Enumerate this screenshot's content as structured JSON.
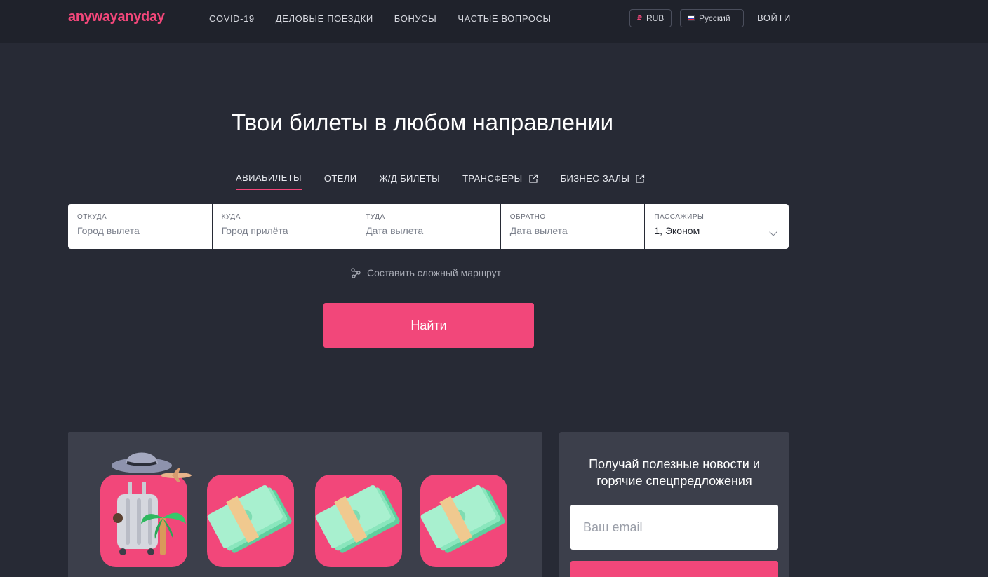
{
  "brand": {
    "part1": "anyway",
    "part2": "anyday"
  },
  "nav": [
    "COVID-19",
    "ДЕЛОВЫЕ ПОЕЗДКИ",
    "БОНУСЫ",
    "ЧАСТЫЕ ВОПРОСЫ"
  ],
  "header": {
    "currency_symbol": "₽",
    "currency": "RUB",
    "language": "Русский",
    "login": "ВОЙТИ"
  },
  "hero": {
    "title": "Твои билеты в любом направлении"
  },
  "tabs": [
    {
      "label": "АВИАБИЛЕТЫ",
      "active": true,
      "external": false
    },
    {
      "label": "ОТЕЛИ",
      "active": false,
      "external": false
    },
    {
      "label": "Ж/Д БИЛЕТЫ",
      "active": false,
      "external": false
    },
    {
      "label": "ТРАНСФЕРЫ",
      "active": false,
      "external": true
    },
    {
      "label": "БИЗНЕС-ЗАЛЫ",
      "active": false,
      "external": true
    }
  ],
  "search": {
    "from": {
      "label": "ОТКУДА",
      "placeholder": "Город вылета"
    },
    "to": {
      "label": "КУДА",
      "placeholder": "Город прилёта"
    },
    "depart": {
      "label": "ТУДА",
      "placeholder": "Дата вылета"
    },
    "return": {
      "label": "ОБРАТНО",
      "placeholder": "Дата вылета"
    },
    "passengers": {
      "label": "ПАССАЖИРЫ",
      "value": "1, Эконом"
    }
  },
  "complex_route": "Составить сложный маршрут",
  "find_button": "Найти",
  "newsletter": {
    "title_line1": "Получай полезные новости и",
    "title_line2": "горячие спецпредложения",
    "email_placeholder": "Ваш email"
  },
  "colors": {
    "accent": "#f2477a",
    "background": "#272a35",
    "header": "#1f222b",
    "card": "#3c3f4b"
  }
}
